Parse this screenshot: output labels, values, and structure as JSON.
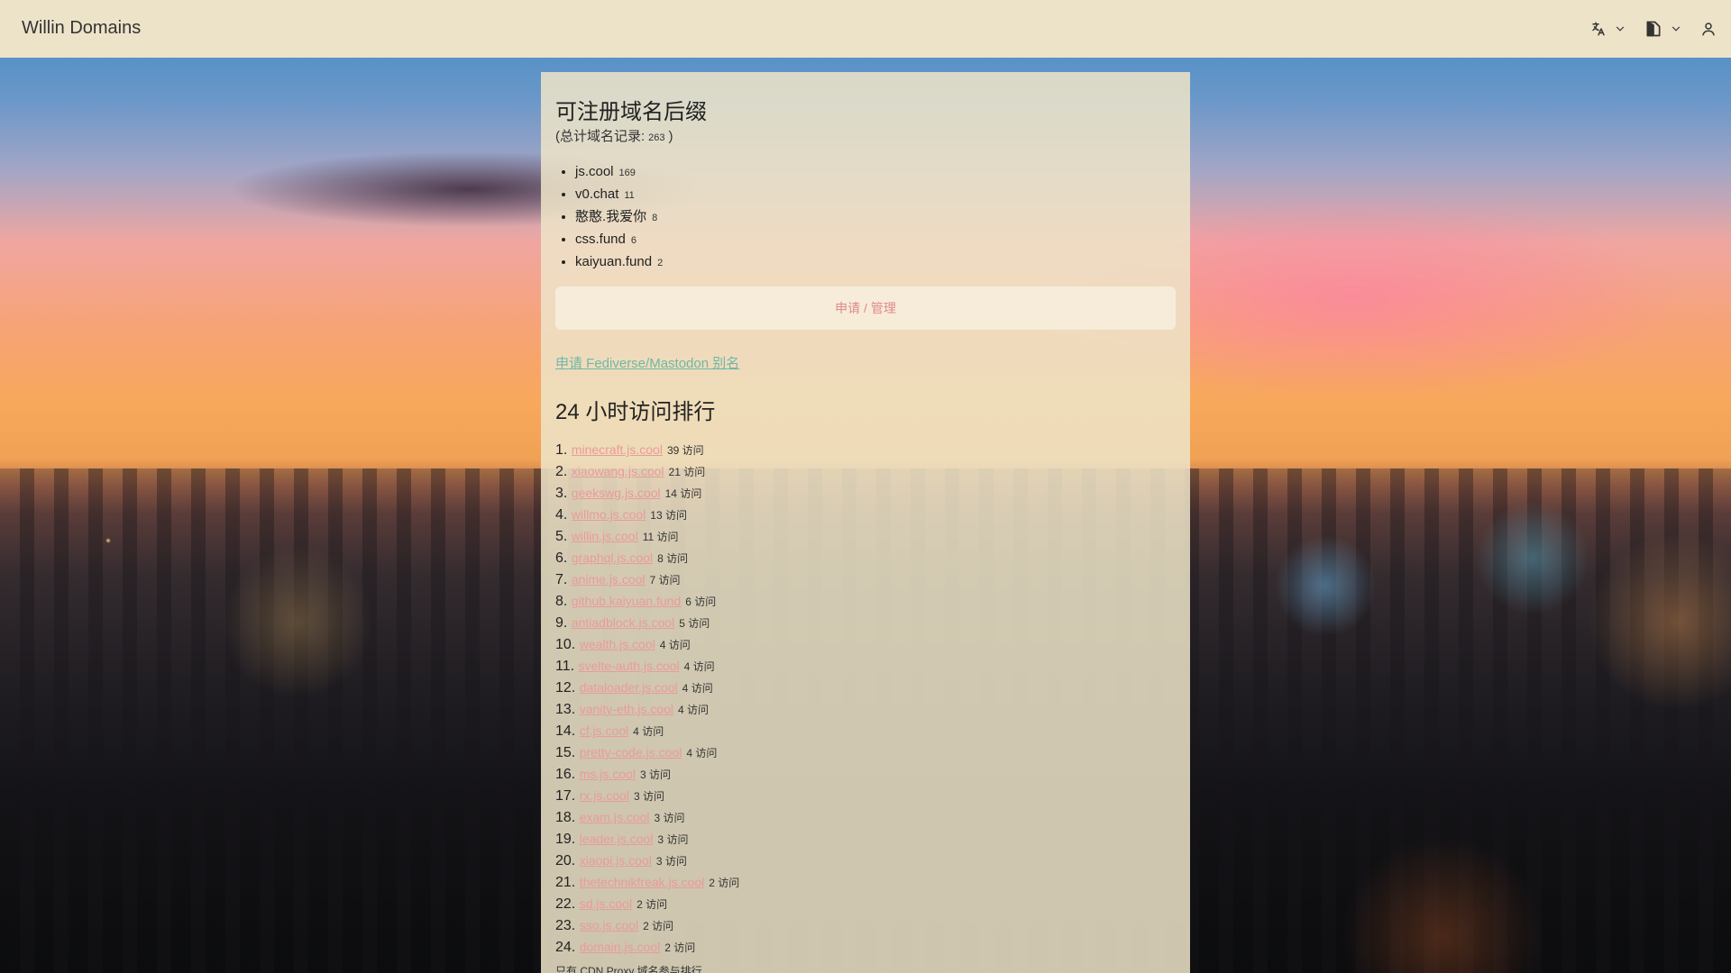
{
  "app": {
    "title": "Willin Domains"
  },
  "header": {
    "language_icon": "translate-icon",
    "theme_icon": "theme-icon",
    "user_icon": "user-icon"
  },
  "suffixes": {
    "title": "可注册域名后缀",
    "total_prefix": "(总计域名记录:",
    "total_value": "263",
    "total_suffix": ")",
    "items": [
      {
        "name": "js.cool",
        "count": "169"
      },
      {
        "name": "v0.chat",
        "count": "11"
      },
      {
        "name": "憨憨.我爱你",
        "count": "8"
      },
      {
        "name": "css.fund",
        "count": "6"
      },
      {
        "name": "kaiyuan.fund",
        "count": "2"
      }
    ]
  },
  "apply_button": {
    "label": "申请 / 管理"
  },
  "fediverse_link": {
    "label": "申请 Fediverse/Mastodon 别名"
  },
  "ranking": {
    "title": "24 小时访问排行",
    "unit": "访问",
    "items": [
      {
        "rank": "1.",
        "domain": "minecraft.js.cool",
        "visits": "39"
      },
      {
        "rank": "2.",
        "domain": "xiaowang.js.cool",
        "visits": "21"
      },
      {
        "rank": "3.",
        "domain": "geekswg.js.cool",
        "visits": "14"
      },
      {
        "rank": "4.",
        "domain": "willmo.js.cool",
        "visits": "13"
      },
      {
        "rank": "5.",
        "domain": "willin.js.cool",
        "visits": "11"
      },
      {
        "rank": "6.",
        "domain": "graphql.js.cool",
        "visits": "8"
      },
      {
        "rank": "7.",
        "domain": "anime.js.cool",
        "visits": "7"
      },
      {
        "rank": "8.",
        "domain": "github.kaiyuan.fund",
        "visits": "6"
      },
      {
        "rank": "9.",
        "domain": "antiadblock.js.cool",
        "visits": "5"
      },
      {
        "rank": "10.",
        "domain": "wealth.js.cool",
        "visits": "4"
      },
      {
        "rank": "11.",
        "domain": "svelte-auth.js.cool",
        "visits": "4"
      },
      {
        "rank": "12.",
        "domain": "dataloader.js.cool",
        "visits": "4"
      },
      {
        "rank": "13.",
        "domain": "vanity-eth.js.cool",
        "visits": "4"
      },
      {
        "rank": "14.",
        "domain": "cf.js.cool",
        "visits": "4"
      },
      {
        "rank": "15.",
        "domain": "pretty-code.js.cool",
        "visits": "4"
      },
      {
        "rank": "16.",
        "domain": "ms.js.cool",
        "visits": "3"
      },
      {
        "rank": "17.",
        "domain": "rx.js.cool",
        "visits": "3"
      },
      {
        "rank": "18.",
        "domain": "exam.js.cool",
        "visits": "3"
      },
      {
        "rank": "19.",
        "domain": "leader.js.cool",
        "visits": "3"
      },
      {
        "rank": "20.",
        "domain": "xiaopi.js.cool",
        "visits": "3"
      },
      {
        "rank": "21.",
        "domain": "thetechnikfreak.js.cool",
        "visits": "2"
      },
      {
        "rank": "22.",
        "domain": "sd.js.cool",
        "visits": "2"
      },
      {
        "rank": "23.",
        "domain": "sso.js.cool",
        "visits": "2"
      },
      {
        "rank": "24.",
        "domain": "domain.js.cool",
        "visits": "2"
      }
    ]
  },
  "footer_note": "只有 CDN Proxy 域名参与排行"
}
